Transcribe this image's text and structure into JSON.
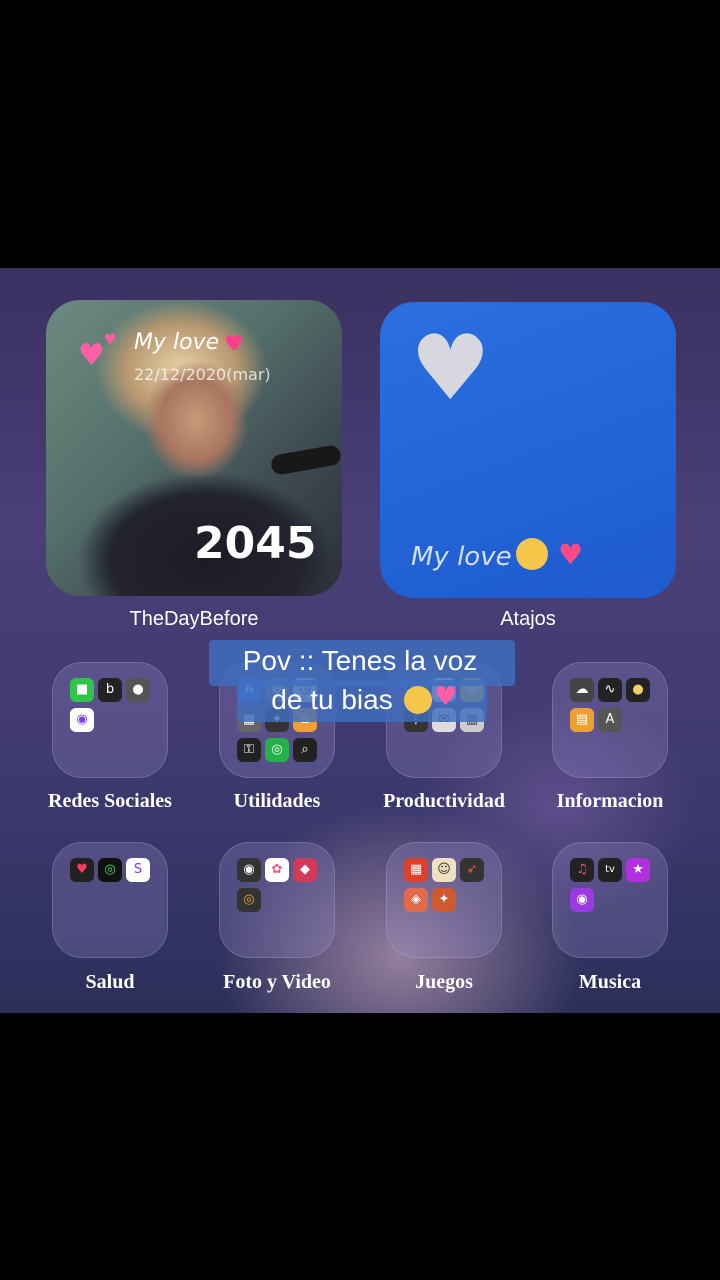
{
  "widgets": {
    "photo": {
      "title": "My love",
      "date": "22/12/2020(mar)",
      "count": "2045",
      "label": "TheDayBefore"
    },
    "shortcut": {
      "text": "My love",
      "label": "Atajos"
    }
  },
  "folders": [
    {
      "label": "Redes Sociales"
    },
    {
      "label": "Utilidades"
    },
    {
      "label": "Productividad"
    },
    {
      "label": "Informacion"
    },
    {
      "label": "Salud"
    },
    {
      "label": "Foto y Video"
    },
    {
      "label": "Juegos"
    },
    {
      "label": "Musica"
    }
  ],
  "caption": {
    "line1": "Pov :: Tenes la voz",
    "line2": "de tu bias"
  }
}
